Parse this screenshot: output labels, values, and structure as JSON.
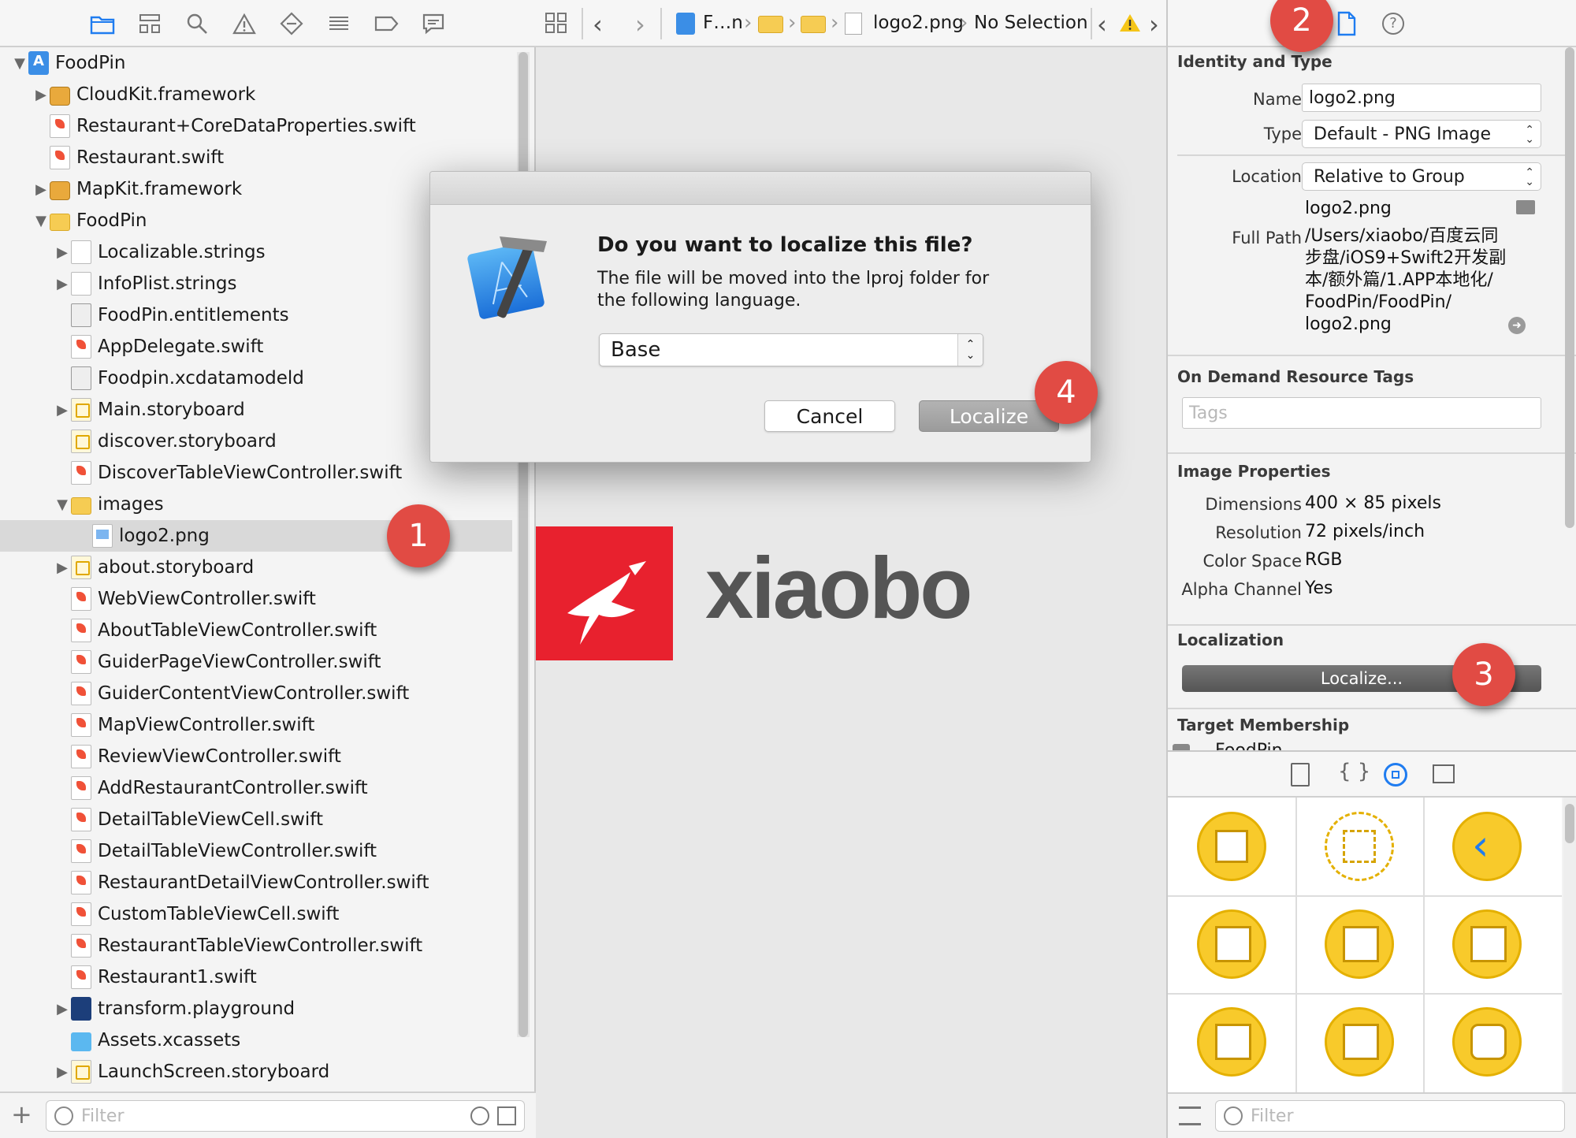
{
  "navigator": {
    "toolbar_icons": [
      "folder-icon",
      "hierarchy-icon",
      "search-icon",
      "warning-icon",
      "test-diamond-icon",
      "list-icon",
      "breakpoint-icon",
      "comment-icon"
    ],
    "tree": [
      {
        "label": "FoodPin",
        "indent": 0,
        "expanded": true,
        "icon": "proj"
      },
      {
        "label": "CloudKit.framework",
        "indent": 1,
        "collapsed": true,
        "icon": "tool"
      },
      {
        "label": "Restaurant+CoreDataProperties.swift",
        "indent": 1,
        "icon": "swift"
      },
      {
        "label": "Restaurant.swift",
        "indent": 1,
        "icon": "swift"
      },
      {
        "label": "MapKit.framework",
        "indent": 1,
        "collapsed": true,
        "icon": "tool"
      },
      {
        "label": "FoodPin",
        "indent": 1,
        "expanded": true,
        "icon": "folder"
      },
      {
        "label": "Localizable.strings",
        "indent": 2,
        "collapsed": true,
        "icon": "doc"
      },
      {
        "label": "InfoPlist.strings",
        "indent": 2,
        "collapsed": true,
        "icon": "doc"
      },
      {
        "label": "FoodPin.entitlements",
        "indent": 2,
        "icon": "ent"
      },
      {
        "label": "AppDelegate.swift",
        "indent": 2,
        "icon": "swift"
      },
      {
        "label": "Foodpin.xcdatamodeld",
        "indent": 2,
        "icon": "ent"
      },
      {
        "label": "Main.storyboard",
        "indent": 2,
        "collapsed": true,
        "icon": "story"
      },
      {
        "label": "discover.storyboard",
        "indent": 2,
        "icon": "story"
      },
      {
        "label": "DiscoverTableViewController.swift",
        "indent": 2,
        "icon": "swift"
      },
      {
        "label": "images",
        "indent": 2,
        "expanded": true,
        "icon": "folder"
      },
      {
        "label": "logo2.png",
        "indent": 3,
        "icon": "png",
        "selected": true
      },
      {
        "label": "about.storyboard",
        "indent": 2,
        "collapsed": true,
        "icon": "story"
      },
      {
        "label": "WebViewController.swift",
        "indent": 2,
        "icon": "swift"
      },
      {
        "label": "AboutTableViewController.swift",
        "indent": 2,
        "icon": "swift"
      },
      {
        "label": "GuiderPageViewController.swift",
        "indent": 2,
        "icon": "swift"
      },
      {
        "label": "GuiderContentViewController.swift",
        "indent": 2,
        "icon": "swift"
      },
      {
        "label": "MapViewController.swift",
        "indent": 2,
        "icon": "swift"
      },
      {
        "label": "ReviewViewController.swift",
        "indent": 2,
        "icon": "swift"
      },
      {
        "label": "AddRestaurantController.swift",
        "indent": 2,
        "icon": "swift"
      },
      {
        "label": "DetailTableViewCell.swift",
        "indent": 2,
        "icon": "swift"
      },
      {
        "label": "DetailTableViewController.swift",
        "indent": 2,
        "icon": "swift"
      },
      {
        "label": "RestaurantDetailViewController.swift",
        "indent": 2,
        "icon": "swift"
      },
      {
        "label": "CustomTableViewCell.swift",
        "indent": 2,
        "icon": "swift"
      },
      {
        "label": "RestaurantTableViewController.swift",
        "indent": 2,
        "icon": "swift"
      },
      {
        "label": "Restaurant1.swift",
        "indent": 2,
        "icon": "swift"
      },
      {
        "label": "transform.playground",
        "indent": 2,
        "collapsed": true,
        "icon": "play"
      },
      {
        "label": "Assets.xcassets",
        "indent": 2,
        "icon": "assets"
      },
      {
        "label": "LaunchScreen.storyboard",
        "indent": 2,
        "collapsed": true,
        "icon": "story"
      }
    ],
    "filter_placeholder": "Filter"
  },
  "jumpbar": {
    "crumbs": [
      "F…n",
      "logo2.png",
      "No Selection"
    ]
  },
  "editor": {
    "logo_text": "xiaobo",
    "logo_color": "#e8212e"
  },
  "dialog": {
    "title": "Do you want to localize this file?",
    "message": "The file will be moved into the lproj folder for the following language.",
    "language": "Base",
    "cancel": "Cancel",
    "localize": "Localize"
  },
  "inspector": {
    "identity_title": "Identity and Type",
    "name_label": "Name",
    "name_value": "logo2.png",
    "type_label": "Type",
    "type_value": "Default - PNG Image",
    "location_label": "Location",
    "location_value": "Relative to Group",
    "location_file": "logo2.png",
    "fullpath_label": "Full Path",
    "fullpath_lines": [
      "/Users/xiaobo/百度云同",
      "步盘/iOS9+Swift2开发副",
      "本/额外篇/1.APP本地化/",
      "FoodPin/FoodPin/",
      "logo2.png"
    ],
    "odr_title": "On Demand Resource Tags",
    "tags_placeholder": "Tags",
    "image_title": "Image Properties",
    "props": [
      {
        "label": "Dimensions",
        "value": "400 × 85 pixels"
      },
      {
        "label": "Resolution",
        "value": "72 pixels/inch"
      },
      {
        "label": "Color Space",
        "value": "RGB"
      },
      {
        "label": "Alpha Channel",
        "value": "Yes"
      }
    ],
    "localization_title": "Localization",
    "localize_button": "Localize...",
    "target_title": "Target Membership",
    "target_partial": "FoodPin",
    "filter_placeholder": "Filter"
  },
  "badges": [
    "1",
    "2",
    "3",
    "4"
  ]
}
